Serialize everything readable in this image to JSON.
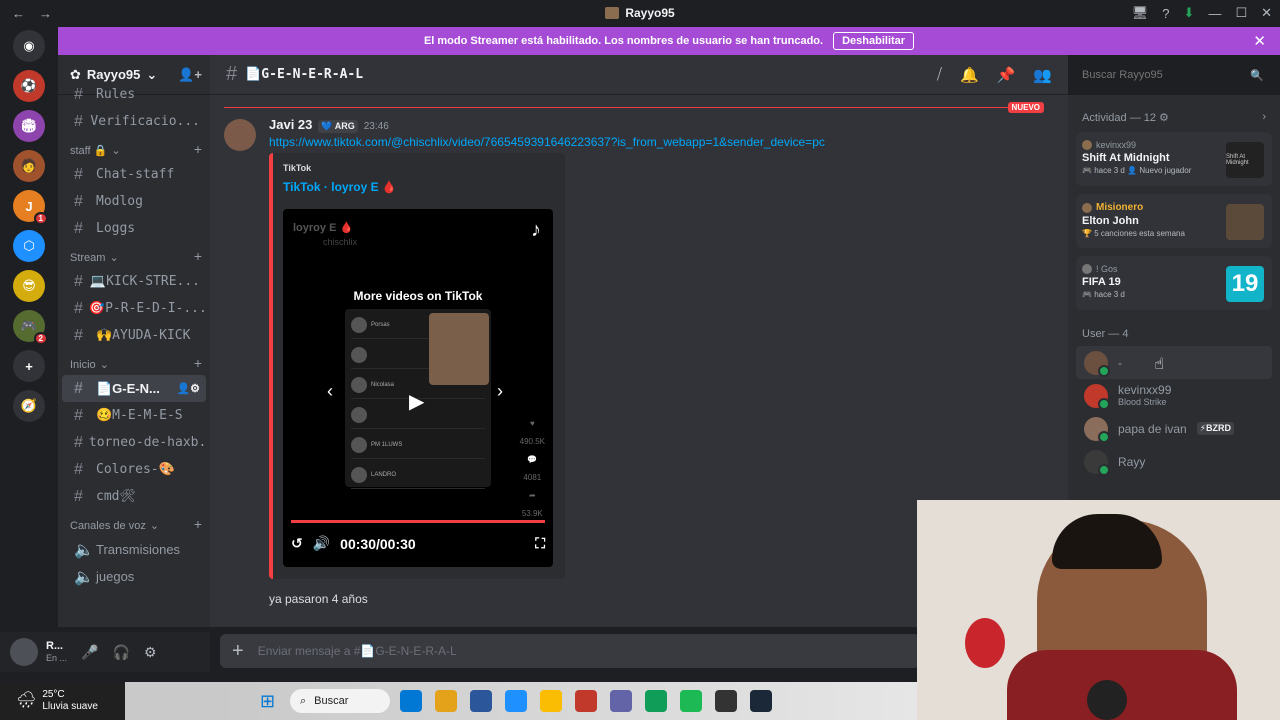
{
  "window": {
    "title": "Rayyo95",
    "back": "←",
    "forward": "→",
    "controls": [
      "🖥",
      "?",
      "⬇",
      "—",
      "☐",
      "✕"
    ]
  },
  "banner": {
    "text": "El modo Streamer está habilitado. Los nombres de usuario se han truncado.",
    "button": "Deshabilitar",
    "close": "✕"
  },
  "servers": [
    {
      "label": "⚽",
      "color": "#c0392b"
    },
    {
      "label": "🏟",
      "color": "#8e44ad"
    },
    {
      "label": "🧑",
      "color": "#a0522d"
    },
    {
      "label": "J",
      "color": "#e67e22",
      "badge": "1"
    },
    {
      "label": "⬡",
      "color": "#1e90ff"
    },
    {
      "label": "😎",
      "color": "#d4ac0d"
    },
    {
      "label": "🎮",
      "color": "#556b2f",
      "badge": "2"
    },
    {
      "label": "+",
      "color": "#313338"
    },
    {
      "label": "🧭",
      "color": "#313338"
    }
  ],
  "sidebar": {
    "guild_name": "Rayyo95",
    "guild_chevron": "⌄",
    "add_icon": "👤+",
    "top_channels": [
      {
        "label": "Rules",
        "icon": "📖"
      },
      {
        "label": "Verificacio...",
        "icon": "#"
      }
    ],
    "categories": [
      {
        "name": "staff 🔒",
        "channels": [
          "Chat-staff",
          "Modlog",
          "Loggs"
        ]
      },
      {
        "name": "Stream",
        "channels": [
          "💻KICK-STRE...",
          "🎯P-R-E-D-I-...",
          "🙌AYUDA-KICK"
        ]
      },
      {
        "name": "Inicio",
        "channels": [
          "📄G-E-N...",
          "🥴M-E-M-E-S",
          "torneo-de-haxb...",
          "Colores-🎨",
          "cmd🛠"
        ]
      }
    ],
    "voice_category": "Canales de voz",
    "voice_channels": [
      "Transmisiones",
      "juegos"
    ],
    "active_channel": "📄G-E-N..."
  },
  "user_panel": {
    "name": "R...",
    "status": "En ...",
    "mic": "🎤",
    "headset": "🎧",
    "settings": "⚙"
  },
  "channel_header": {
    "name": "📄G-E-N-E-R-A-L",
    "tools": [
      "⧸",
      "🔔",
      "📌",
      "👥"
    ]
  },
  "search": {
    "placeholder": "Buscar Rayyo95",
    "icon": "🔍"
  },
  "chat": {
    "new_tag": "NUEVO",
    "message": {
      "author": "Javi 23",
      "tag": "💙 ARG",
      "time": "23:46",
      "link": "https://www.tiktok.com/@chischlix/video/7665459391646223637?is_from_webapp=1&sender_device=pc",
      "embed": {
        "provider": "TikTok",
        "title": "TikTok · loyroy E 🩸",
        "video": {
          "user": "loyroy E 🩸",
          "handle": "chischlix",
          "more_videos": "More videos on TikTok",
          "rows": [
            "Porsas",
            "",
            "Nicolasa",
            "",
            "PM 1LUWS",
            "LANDRO"
          ],
          "likes": "490.5K",
          "comments": "4081",
          "shares": "53.9K",
          "time": "00:30/00:30",
          "progress": 1.0
        }
      }
    },
    "reply": "ya pasaron 4 años"
  },
  "composer": {
    "placeholder": "Enviar mensaje a #📄G-E-N-E-R-A-L"
  },
  "members": {
    "activity_header": "Actividad — 12 ⚙",
    "activities": [
      {
        "user": "kevinxx99",
        "game": "Shift At Midnight",
        "status": "hace 3 d",
        "extra": "Nuevo jugador",
        "thumb": "Shift At Midnight"
      },
      {
        "user": "Misionero",
        "game": "Elton John",
        "status": "5 canciones esta semana",
        "extra": "",
        "thumb": ""
      },
      {
        "user": "! Gos",
        "game": "FIFA 19",
        "status": "hace 3 d",
        "extra": "",
        "thumb": "19"
      }
    ],
    "user_header": "User — 4",
    "users": [
      {
        "name": "-",
        "status": "",
        "tag": ""
      },
      {
        "name": "kevinxx99",
        "status": "Blood Strike",
        "tag": ""
      },
      {
        "name": "papa de ivan",
        "status": "",
        "tag": "⚡BZRD"
      },
      {
        "name": "Rayy",
        "status": "",
        "tag": ""
      }
    ]
  },
  "taskbar": {
    "temp": "25°C",
    "weather": "Lluvia suave",
    "search": "Buscar",
    "apps": [
      "#0078d4",
      "#e3a21a",
      "#2b579a",
      "#1e90ff",
      "#fbbc04",
      "#c0392b",
      "#6264a7",
      "#0f9d58",
      "#1db954",
      "#333333",
      "#1b2838"
    ]
  }
}
